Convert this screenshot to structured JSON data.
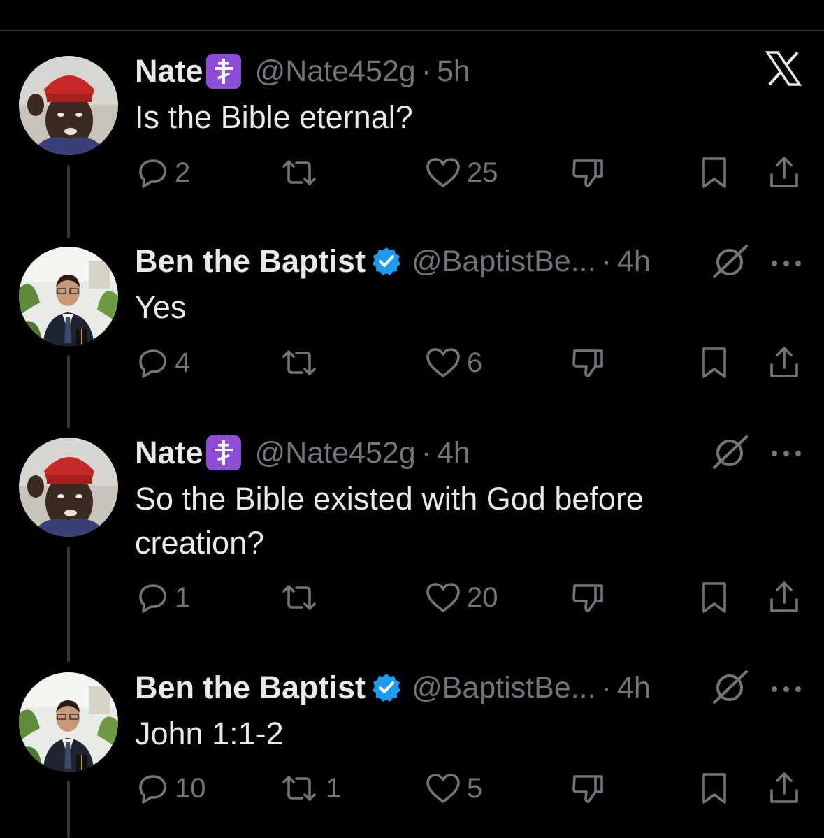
{
  "platform": "X",
  "tweets": [
    {
      "name": "Nate",
      "handle": "@Nate452g",
      "time": "5h",
      "text": "Is the Bible eternal?",
      "replies": "2",
      "reposts": "",
      "likes": "25",
      "verified": false,
      "name_badge": "orthodox-cross"
    },
    {
      "name": "Ben the Baptist",
      "handle": "@BaptistBe...",
      "time": "4h",
      "text": "Yes",
      "replies": "4",
      "reposts": "",
      "likes": "6",
      "verified": true
    },
    {
      "name": "Nate",
      "handle": "@Nate452g",
      "time": "4h",
      "text": "So the Bible existed with God before creation?",
      "replies": "1",
      "reposts": "",
      "likes": "20",
      "verified": false,
      "name_badge": "orthodox-cross"
    },
    {
      "name": "Ben the Baptist",
      "handle": "@BaptistBe...",
      "time": "4h",
      "text": "John 1:1-2",
      "replies": "10",
      "reposts": "1",
      "likes": "5",
      "verified": true
    }
  ],
  "colors": {
    "background": "#000000",
    "primary_text": "#e7e9ea",
    "secondary_text": "#71767b",
    "verified_blue": "#1d9bf0",
    "badge_purple": "#8f4ed6",
    "thread_line": "#333639"
  },
  "icons": [
    "x-logo-icon",
    "reply-icon",
    "repost-icon",
    "like-icon",
    "dislike-icon",
    "bookmark-icon",
    "share-icon",
    "grok-icon",
    "more-icon",
    "verified-icon",
    "orthodox-cross-icon"
  ]
}
